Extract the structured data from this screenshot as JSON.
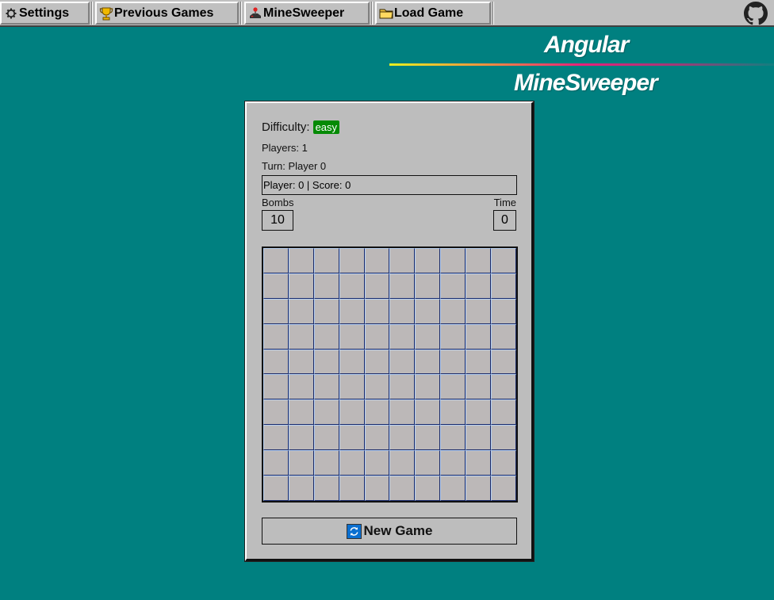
{
  "taskbar": {
    "items": [
      {
        "label": "Settings",
        "icon": "gear-icon"
      },
      {
        "label": "Previous Games",
        "icon": "trophy-icon"
      },
      {
        "label": "MineSweeper",
        "icon": "joystick-icon"
      },
      {
        "label": "Load Game",
        "icon": "folder-icon"
      }
    ],
    "github_icon": "github-icon"
  },
  "header": {
    "title_line1": "Angular",
    "title_line2": "MineSweeper"
  },
  "game": {
    "difficulty_label": "Difficulty:",
    "difficulty_value": "easy",
    "difficulty_color": "#058a05",
    "players": "Players: 1",
    "turn": "Turn: Player 0",
    "score_line": "Player: 0 | Score: 0",
    "bombs_label": "Bombs",
    "bombs_value": "10",
    "time_label": "Time",
    "time_value": "0",
    "board": {
      "rows": 10,
      "cols": 10,
      "state": "all-hidden"
    },
    "new_game_label": "New Game",
    "new_game_icon": "refresh-icon"
  },
  "colors": {
    "desktop": "#008080",
    "panel": "#bdbdbd",
    "cell": "#bcb8b8"
  }
}
